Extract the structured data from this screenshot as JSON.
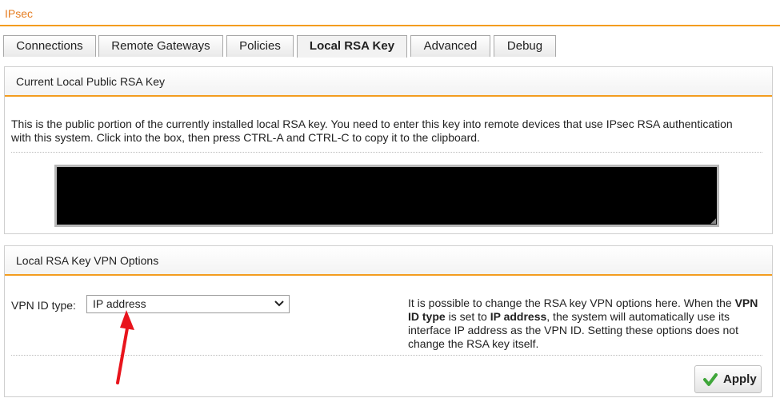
{
  "page": {
    "title": "IPsec"
  },
  "tabs": [
    {
      "label": "Connections"
    },
    {
      "label": "Remote Gateways"
    },
    {
      "label": "Policies"
    },
    {
      "label": "Local RSA Key",
      "active": true
    },
    {
      "label": "Advanced"
    },
    {
      "label": "Debug"
    }
  ],
  "rsa_panel": {
    "header": "Current Local Public RSA Key",
    "description": "This is the public portion of the currently installed local RSA key. You need to enter this key into remote devices that use IPsec RSA authentication with this system. Click into the box, then press CTRL-A and CTRL-C to copy it to the clipboard."
  },
  "vpn_panel": {
    "header": "Local RSA Key VPN Options",
    "vpn_id_label": "VPN ID type:",
    "vpn_id_value": "IP address",
    "help": {
      "t1": "It is possible to change the RSA key VPN options here. When the ",
      "b1": "VPN ID type",
      "t2": " is set to ",
      "b2": "IP address",
      "t3": ", the system will automatically use its interface IP address as the VPN ID. Setting these options does not change the RSA key itself."
    },
    "apply_label": "Apply"
  },
  "colors": {
    "accent": "#f39c1f",
    "title": "#e67e22",
    "check": "#3fa63a",
    "arrow": "#e8141c"
  },
  "icons": {
    "select_chevron": "chevron-down-icon",
    "apply": "checkmark-icon",
    "annotation": "red-arrow-icon"
  }
}
